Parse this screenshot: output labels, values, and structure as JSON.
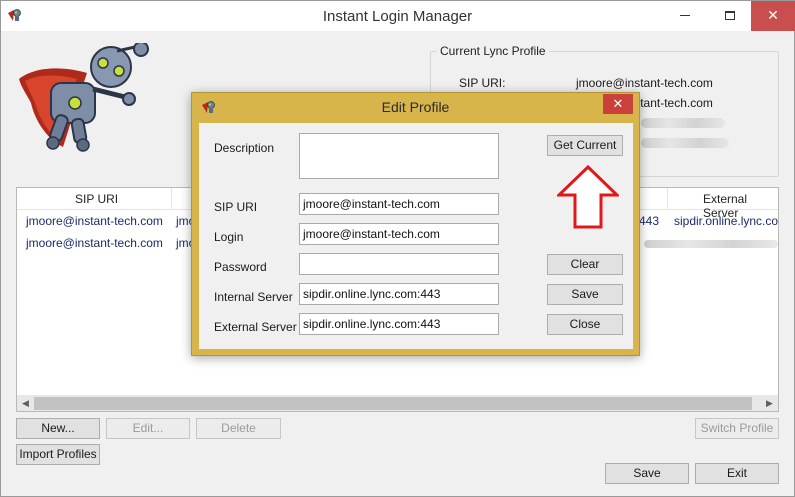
{
  "window": {
    "title": "Instant Login Manager",
    "minimize": "—",
    "maximize": "□",
    "close": "✕"
  },
  "current_profile": {
    "legend": "Current Lync Profile",
    "sip_uri_label": "SIP URI:",
    "sip_uri_value": "jmoore@instant-tech.com",
    "login_value": "jmoore@instant-tech.com"
  },
  "grid": {
    "columns": [
      "SIP URI",
      "External Server"
    ],
    "rows": [
      {
        "sip_uri": "jmoore@instant-tech.com",
        "login_prefix": "jmo",
        "internal_suffix": "443",
        "external": "sipdir.online.lync.com"
      },
      {
        "sip_uri": "jmoore@instant-tech.com",
        "login_prefix": "jmo",
        "internal_suffix": "",
        "external": ""
      }
    ]
  },
  "buttons": {
    "new": "New...",
    "edit": "Edit...",
    "delete": "Delete",
    "switch_profile": "Switch Profile",
    "import_profiles": "Import Profiles",
    "save": "Save",
    "exit": "Exit"
  },
  "dialog": {
    "title": "Edit Profile",
    "close": "✕",
    "labels": {
      "description": "Description",
      "sip_uri": "SIP URI",
      "login": "Login",
      "password": "Password",
      "internal_server": "Internal Server",
      "external_server": "External Server"
    },
    "values": {
      "description": "",
      "sip_uri": "jmoore@instant-tech.com",
      "login": "jmoore@instant-tech.com",
      "password": "",
      "internal_server": "sipdir.online.lync.com:443",
      "external_server": "sipdir.online.lync.com:443"
    },
    "buttons": {
      "get_current": "Get Current",
      "clear": "Clear",
      "save": "Save",
      "close": "Close"
    }
  },
  "colors": {
    "dialog_frame": "#d8b54a",
    "close_red": "#c94f4f",
    "annotation_arrow": "#e01818",
    "link_text": "#1a2b6a"
  },
  "icons": {
    "app": "robot-app-icon",
    "annotation": "up-arrow-annotation"
  }
}
